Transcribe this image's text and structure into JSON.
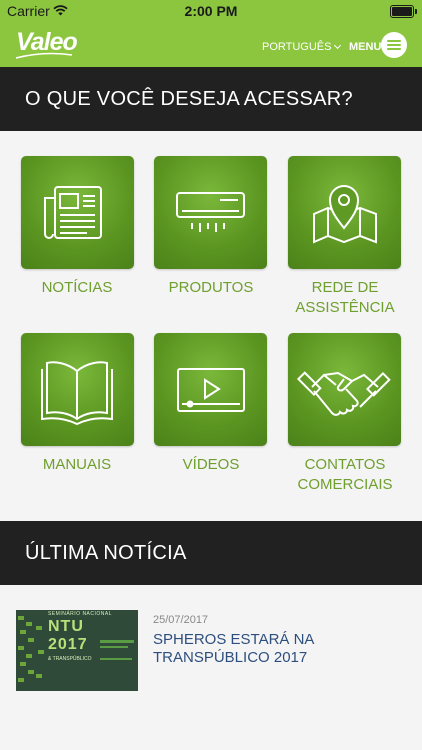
{
  "status": {
    "carrier": "Carrier",
    "time": "2:00 PM"
  },
  "nav": {
    "logo": "Valeo",
    "language": "PORTUGUÊS",
    "menu_label": "MENU"
  },
  "sections": {
    "access_title": "O QUE VOCÊ DESEJA ACESSAR?",
    "news_title": "ÚLTIMA NOTÍCIA"
  },
  "tiles": [
    {
      "label": "NOTÍCIAS",
      "icon": "newspaper-icon"
    },
    {
      "label": "PRODUTOS",
      "icon": "air-conditioner-icon"
    },
    {
      "label": "REDE DE ASSISTÊNCIA",
      "icon": "map-pin-icon"
    },
    {
      "label": "MANUAIS",
      "icon": "open-book-icon"
    },
    {
      "label": "VÍDEOS",
      "icon": "video-player-icon"
    },
    {
      "label": "CONTATOS COMERCIAIS",
      "icon": "handshake-icon"
    }
  ],
  "latest_news": {
    "date": "25/07/2017",
    "title": "SPHEROS ESTARÁ NA TRANSPÚBLICO 2017",
    "thumbnail": {
      "event": "SEMINÁRIO NACIONAL",
      "brand": "NTU",
      "year": "2017",
      "subtitle": "& TRANSPÚBLICO"
    }
  },
  "colors": {
    "brand_green": "#8cc63f",
    "tile_green": "#5a9420",
    "dark_bar": "#212121",
    "label_green": "#6f9f2e",
    "news_title": "#2d4f7e"
  }
}
